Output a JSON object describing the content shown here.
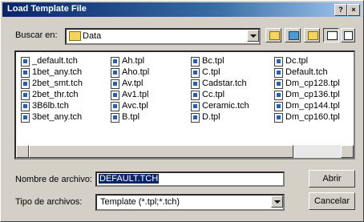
{
  "window": {
    "title": "Load Template File",
    "help": "?",
    "close": "×"
  },
  "lookin": {
    "label": "Buscar en:",
    "value": "Data"
  },
  "files": [
    [
      "_default.tch",
      "1bet_any.tch",
      "2bet_smt.tch",
      "2bet_thr.tch",
      "3B6lb.tch",
      "3bet_any.tch"
    ],
    [
      "Ah.tpl",
      "Aho.tpl",
      "Av.tpl",
      "Av1.tpl",
      "Avc.tpl",
      "B.tpl"
    ],
    [
      "Bc.tpl",
      "C.tpl",
      "Cadstar.tch",
      "Cc.tpl",
      "Ceramic.tch",
      "D.tpl"
    ],
    [
      "Dc.tpl",
      "Default.tch",
      "Dm_cp128.tpl",
      "Dm_cp136.tpl",
      "Dm_cp144.tpl",
      "Dm_cp160.tpl"
    ]
  ],
  "filename": {
    "label": "Nombre de archivo:",
    "value": "DEFAULT.TCH"
  },
  "filetype": {
    "label": "Tipo de archivos:",
    "value": "Template (*.tpl;*.tch)"
  },
  "buttons": {
    "open": "Abrir",
    "cancel": "Cancelar"
  }
}
